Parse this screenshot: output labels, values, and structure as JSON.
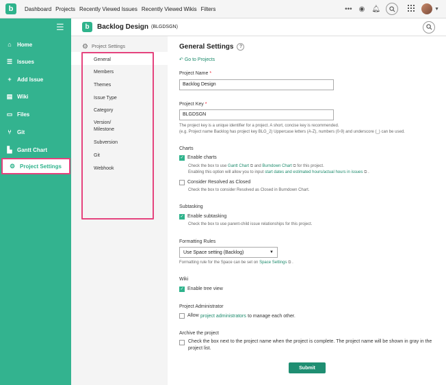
{
  "topbar": {
    "logo": "b",
    "nav": [
      "Dashboard",
      "Projects",
      "Recently Viewed Issues",
      "Recently Viewed Wikis",
      "Filters"
    ],
    "icons": [
      "more-icon",
      "watch-icon",
      "bell-icon",
      "search-icon",
      "apps-icon",
      "avatar"
    ]
  },
  "sidebar": {
    "items": [
      {
        "label": "Home",
        "icon": "home-icon"
      },
      {
        "label": "Issues",
        "icon": "issues-icon"
      },
      {
        "label": "Add Issue",
        "icon": "add-icon"
      },
      {
        "label": "Wiki",
        "icon": "wiki-icon"
      },
      {
        "label": "Files",
        "icon": "files-icon"
      },
      {
        "label": "Git",
        "icon": "git-icon"
      },
      {
        "label": "Gantt Chart",
        "icon": "gantt-icon"
      },
      {
        "label": "Project Settings",
        "icon": "gear-icon"
      }
    ],
    "accent": "#33b38f",
    "highlight": "#e5427d"
  },
  "project": {
    "logo": "b",
    "name": "Backlog Design",
    "key": "(BLGDSGN)"
  },
  "settings_menu": {
    "title": "Project Settings",
    "items": [
      "General",
      "Members",
      "Themes",
      "Issue Type",
      "Category",
      "Version/",
      "Milestone",
      "Subversion",
      "Git",
      "Webhook"
    ]
  },
  "main": {
    "title": "General Settings",
    "help": "?",
    "go_to_projects": "Go to Projects",
    "project_name_label": "Project Name",
    "project_name_value": "Backlog Design",
    "project_key_label": "Project Key",
    "project_key_value": "BLGDSGN",
    "key_desc_1": "The project key is a unique identifier for a project. A short, concise key is recommended.",
    "key_desc_2": "(e.g. Project name Backlog has project key BLG_2) Uppercase letters (A-Z), numbers (0-9) and underscore (_) can be used.",
    "charts_label": "Charts",
    "enable_charts": "Enable charts",
    "charts_desc_a": "Check the box to use",
    "gantt_link": "Gantt Chart",
    "charts_and": "and",
    "burndown_link": "Burndown Chart",
    "charts_desc_b": "for this project.",
    "charts_desc_c": "Enabling this option will allow you to input",
    "hours_link": "start dates and estimated hours/actual hours in issues",
    "charts_desc_end": ".",
    "consider_resolved": "Consider Resolved as Closed",
    "resolved_desc": "Check the box to consider Resolved as Closed in Burndown Chart.",
    "subtasking_label": "Subtasking",
    "enable_subtasking": "Enable subtasking",
    "subtasking_desc": "Check the box to use parent-child issue relationships for this project.",
    "formatting_label": "Formatting Rules",
    "formatting_value": "Use Space setting (Backlog)",
    "formatting_desc": "Formatting rule for the Space can be set on",
    "space_settings_link": "Space Settings",
    "formatting_end": ".",
    "wiki_label": "Wiki",
    "enable_tree": "Enable tree view",
    "admin_label": "Project Administrator",
    "allow_text": "Allow",
    "admin_link": "project administrators",
    "admin_rest": "to manage each other.",
    "archive_label": "Archive the project",
    "archive_desc_1": "Check the box next to the project name when the project is complete. The project name will be shown in gray in the",
    "archive_desc_2": "project list.",
    "submit": "Submit",
    "checks": {
      "charts": true,
      "resolved": false,
      "subtasking": true,
      "tree": true,
      "admin": false,
      "archive": false
    }
  }
}
